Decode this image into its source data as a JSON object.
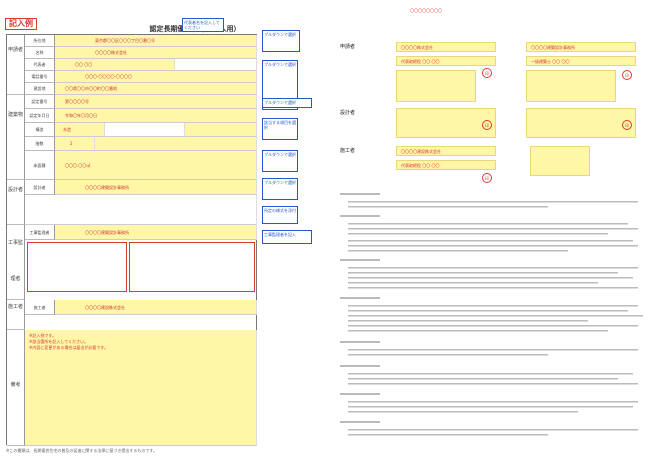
{
  "badge": "記入例",
  "form_title": "認定長期優良住宅（法人用）",
  "left_form": {
    "section_labels": [
      "申請者",
      "建築物",
      "設計者",
      "工事監理者",
      "施工者",
      "備考"
    ],
    "rows": [
      {
        "label": "所在地",
        "value": "東京都〇〇区〇〇〇丁目〇番〇号"
      },
      {
        "label": "名称",
        "value": "〇〇〇〇株式会社"
      },
      {
        "label": "代表者",
        "value": "〇〇 〇〇"
      },
      {
        "label": "電話番号",
        "value": "〇〇〇-〇〇〇〇-〇〇〇〇"
      },
      {
        "label": "建設地",
        "value": "〇〇県〇〇市〇〇町〇〇番地"
      },
      {
        "label": "認定番号",
        "value": "第〇〇〇〇号"
      },
      {
        "label": "認定年月日",
        "value": "令和〇年〇月〇日"
      },
      {
        "label": "構造",
        "value": "木造"
      },
      {
        "label": "階数",
        "value": "2"
      },
      {
        "label": "床面積",
        "value": "〇〇〇.〇〇㎡"
      },
      {
        "label": "設計者",
        "value": "〇〇〇〇建築設計事務所"
      },
      {
        "label": "工事監理者",
        "value": "〇〇〇〇建築設計事務所"
      },
      {
        "label": "施工者",
        "value": "〇〇〇〇建設株式会社"
      }
    ],
    "notes": [
      "※記入例です。",
      "※該当箇所を記入してください。",
      "※内容に変更がある場合は届出が必要です。"
    ],
    "footer": "※この書類は、長期優良住宅の普及の促進に関する法律に基づき提出するものです。"
  },
  "callouts": [
    "代表者名を記入してください",
    "プルダウンで選択",
    "プルダウンで選択",
    "プルダウンで選択",
    "該当する項目を選択",
    "プルダウンで選択",
    "プルダウンで選択",
    "所定の様式を添付",
    "工事監理者を記入"
  ],
  "right_doc": {
    "signers": [
      {
        "label": "申請者",
        "name": "〇〇〇〇株式会社",
        "rep": "代表取締役 〇〇 〇〇"
      },
      {
        "label": "設計者",
        "name": "〇〇〇〇建築設計事務所",
        "rep": "一級建築士 〇〇 〇〇"
      },
      {
        "label": "施工者",
        "name": "〇〇〇〇建設株式会社",
        "rep": "代表取締役 〇〇 〇〇"
      }
    ],
    "seal": "印",
    "page_footer": "〇〇〇〇〇〇〇〇"
  }
}
